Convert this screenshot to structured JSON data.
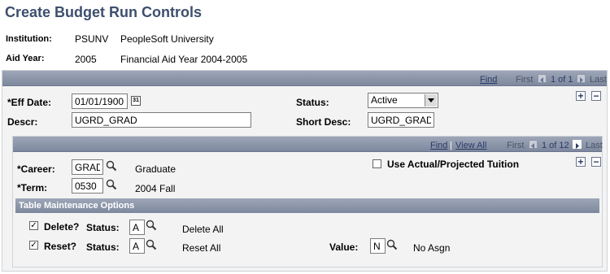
{
  "page": {
    "title": "Create Budget Run Controls"
  },
  "header": {
    "institution_label": "Institution:",
    "institution_code": "PSUNV",
    "institution_name": "PeopleSoft University",
    "aid_year_label": "Aid Year:",
    "aid_year": "2005",
    "aid_year_name": "Financial Aid Year 2004-2005"
  },
  "outer_nav": {
    "find": "Find",
    "first": "First",
    "count": "1 of 1",
    "last": "Last"
  },
  "outer_form": {
    "eff_date_label": "*Eff Date:",
    "eff_date_value": "01/01/1900",
    "calendar_glyph": "31",
    "status_label": "Status:",
    "status_value": "Active",
    "descr_label": "Descr:",
    "descr_value": "UGRD_GRAD",
    "short_desc_label": "Short Desc:",
    "short_desc_value": "UGRD_GRAD"
  },
  "inner_nav": {
    "find": "Find",
    "separator": "|",
    "view_all": "View All",
    "first": "First",
    "count": "1 of 12",
    "last": "Last"
  },
  "inner_form": {
    "career_label": "*Career:",
    "career_value": "GRAD",
    "career_desc": "Graduate",
    "term_label": "*Term:",
    "term_value": "0530",
    "term_desc": "2004 Fall",
    "use_actual_label": "Use Actual/Projected Tuition"
  },
  "table_maint": {
    "header": "Table Maintenance Options",
    "delete_label": "Delete?",
    "delete_checked": true,
    "delete_status_label": "Status:",
    "delete_status_value": "A",
    "delete_status_desc": "Delete All",
    "reset_label": "Reset?",
    "reset_checked": true,
    "reset_status_label": "Status:",
    "reset_status_value": "A",
    "reset_status_desc": "Reset All",
    "value_label": "Value:",
    "value_value": "N",
    "value_desc": "No Asgn"
  },
  "icons": {
    "plus": "+",
    "minus": "−",
    "check": "✓"
  },
  "colors": {
    "title": "#3d4f6e",
    "nav_bar": "#8891a6",
    "link": "#2a3a66"
  }
}
